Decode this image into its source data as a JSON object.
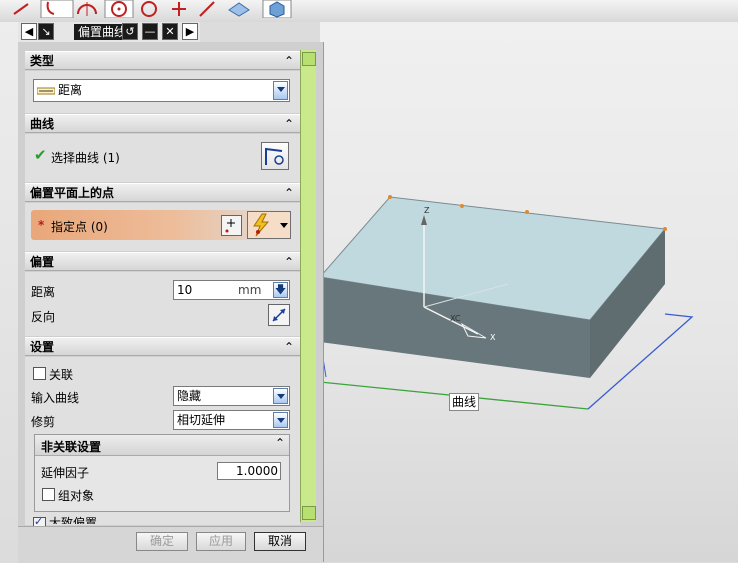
{
  "dialog": {
    "title": "偏置曲线",
    "sections": {
      "type": {
        "header": "类型",
        "selected": "距离"
      },
      "curve": {
        "header": "曲线",
        "select_label": "选择曲线 (1)"
      },
      "point": {
        "header": "偏置平面上的点",
        "specify_label": "指定点 (0)"
      },
      "offset": {
        "header": "偏置",
        "distance_label": "距离",
        "distance_value": "10",
        "distance_unit": "mm",
        "reverse_label": "反向"
      },
      "settings": {
        "header": "设置",
        "associative_label": "关联",
        "input_curve_label": "输入曲线",
        "input_curve_value": "隐藏",
        "trim_label": "修剪",
        "trim_value": "相切延伸",
        "nonassoc": {
          "header": "非关联设置",
          "extend_factor_label": "延伸因子",
          "extend_factor_value": "1.0000",
          "group_label": "组对象"
        },
        "partial_label": "大致偏置"
      }
    },
    "buttons": {
      "ok": "确定",
      "apply": "应用",
      "cancel": "取消"
    }
  },
  "viewport": {
    "curve_label": "曲线",
    "axes": {
      "z": "Z",
      "xc": "XC",
      "x": "X"
    }
  },
  "colors": {
    "accent_green": "#22a02a",
    "highlight_orange": "#e9a77a",
    "scroll_green": "#c9e98a"
  }
}
